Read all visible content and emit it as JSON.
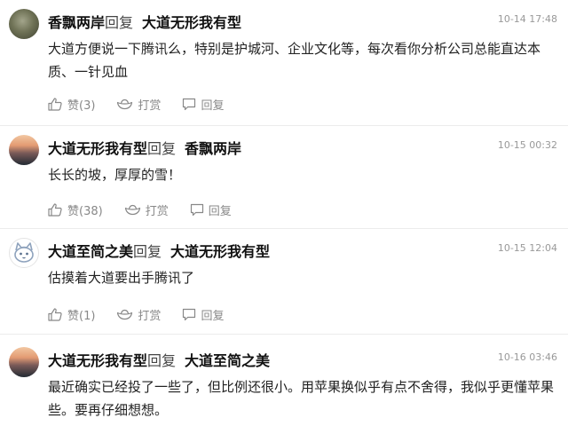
{
  "comments": [
    {
      "user": "香飘两岸",
      "reply_word": "回复",
      "target": "大道无形我有型",
      "time": "10-14 17:48",
      "text": "大道方便说一下腾讯么，特别是护城河、企业文化等，每次看你分析公司总能直达本质、一针见血",
      "like": "赞(3)",
      "reward": "打赏",
      "reply": "回复"
    },
    {
      "user": "大道无形我有型",
      "reply_word": "回复",
      "target": "香飘两岸",
      "time": "10-15 00:32",
      "text": "长长的坡，厚厚的雪！",
      "like": "赞(38)",
      "reward": "打赏",
      "reply": "回复"
    },
    {
      "user": "大道至简之美",
      "reply_word": "回复",
      "target": "大道无形我有型",
      "time": "10-15 12:04",
      "text": "估摸着大道要出手腾讯了",
      "like": "赞(1)",
      "reward": "打赏",
      "reply": "回复"
    },
    {
      "user": "大道无形我有型",
      "reply_word": "回复",
      "target": "大道至简之美",
      "time": "10-16 03:46",
      "text": "最近确实已经投了一些了，但比例还很小。用苹果换似乎有点不舍得，我似乎更懂苹果些。要再仔细想想。",
      "like": "",
      "reward": "",
      "reply": ""
    }
  ]
}
